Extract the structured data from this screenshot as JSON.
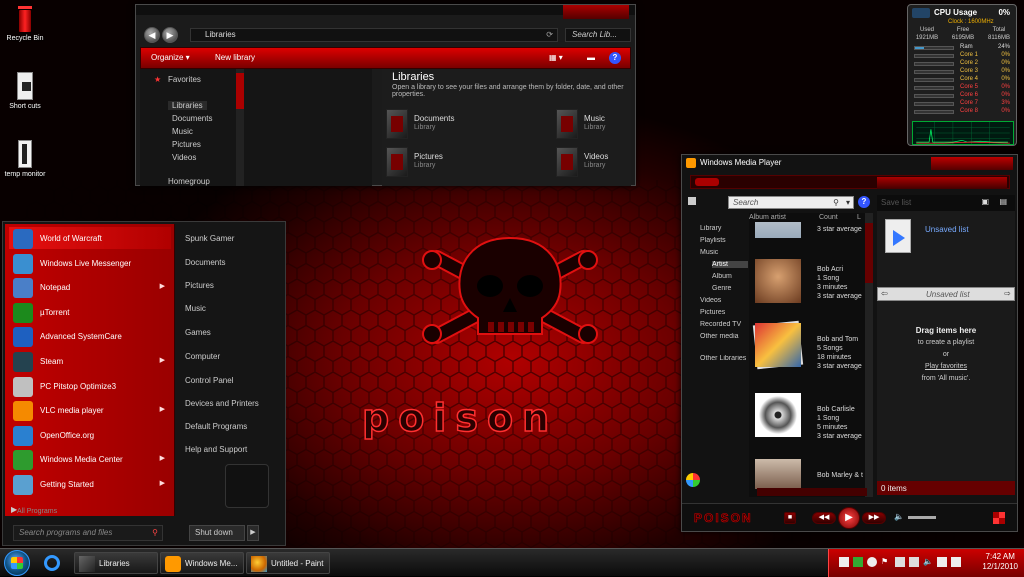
{
  "desktop_icons": [
    {
      "label": "Recycle Bin",
      "icon": "recycle-bin-icon"
    },
    {
      "label": "Short cuts",
      "icon": "shortcuts-folder-icon"
    },
    {
      "label": "temp monitor",
      "icon": "temp-monitor-icon"
    }
  ],
  "theme_logo_text": "poison",
  "explorer": {
    "address": "Libraries",
    "search_placeholder": "Search Lib...",
    "toolbar": {
      "organize": "Organize ▾",
      "new_library": "New library"
    },
    "nav": {
      "favorites": "Favorites",
      "libraries": "Libraries",
      "documents": "Documents",
      "music": "Music",
      "pictures": "Pictures",
      "videos": "Videos",
      "homegroup": "Homegroup"
    },
    "content_title": "Libraries",
    "content_subtitle": "Open a library to see your files and arrange them by folder, date, and other properties.",
    "libraries": [
      {
        "name": "Documents",
        "type": "Library"
      },
      {
        "name": "Music",
        "type": "Library"
      },
      {
        "name": "Pictures",
        "type": "Library"
      },
      {
        "name": "Videos",
        "type": "Library"
      }
    ]
  },
  "cpu_gadget": {
    "title": "CPU Usage",
    "total_percent": "0%",
    "clock": "Clock : 1600MHz",
    "mem_headers": [
      "Used",
      "Free",
      "Total"
    ],
    "mem_values": [
      "1921MB",
      "6195MB",
      "8116MB"
    ],
    "ram_label": "Ram",
    "ram_percent": "24%",
    "cores": [
      {
        "name": "Core 1",
        "value": "0%"
      },
      {
        "name": "Core 2",
        "value": "0%"
      },
      {
        "name": "Core 3",
        "value": "0%"
      },
      {
        "name": "Core 4",
        "value": "0%"
      },
      {
        "name": "Core 5",
        "value": "0%"
      },
      {
        "name": "Core 6",
        "value": "0%"
      },
      {
        "name": "Core 7",
        "value": "3%"
      },
      {
        "name": "Core 8",
        "value": "0%"
      }
    ],
    "colors": {
      "title": "#ffffff",
      "clock": "#f0b000",
      "core_low": "#f0c040",
      "core_high": "#ff4040"
    }
  },
  "start_menu": {
    "programs": [
      {
        "label": "World of Warcraft",
        "icon": "warcraft-icon",
        "arrow": false
      },
      {
        "label": "Windows Live Messenger",
        "icon": "messenger-icon",
        "arrow": false
      },
      {
        "label": "Notepad",
        "icon": "notepad-icon",
        "arrow": true
      },
      {
        "label": "µTorrent",
        "icon": "utorrent-icon",
        "arrow": false
      },
      {
        "label": "Advanced SystemCare",
        "icon": "systemcare-icon",
        "arrow": false
      },
      {
        "label": "Steam",
        "icon": "steam-icon",
        "arrow": true
      },
      {
        "label": "PC Pitstop Optimize3",
        "icon": "pitstop-icon",
        "arrow": false
      },
      {
        "label": "VLC media player",
        "icon": "vlc-icon",
        "arrow": true
      },
      {
        "label": "OpenOffice.org",
        "icon": "openoffice-icon",
        "arrow": false
      },
      {
        "label": "Windows Media Center",
        "icon": "media-center-icon",
        "arrow": true
      },
      {
        "label": "Getting Started",
        "icon": "getting-started-icon",
        "arrow": true
      }
    ],
    "all_programs": "All Programs",
    "right_items": [
      "Spunk Gamer",
      "Documents",
      "Pictures",
      "Music",
      "Games",
      "Computer",
      "Control Panel",
      "Devices and Printers",
      "Default Programs",
      "Help and Support"
    ],
    "search_placeholder": "Search programs and files",
    "shutdown": "Shut down"
  },
  "wmp": {
    "title": "Windows Media Player",
    "search_placeholder": "Search",
    "tree": [
      "Library",
      "Playlists",
      "Music",
      "Artist",
      "Album",
      "Genre",
      "Videos",
      "Pictures",
      "Recorded TV",
      "Other media",
      "Other Libraries"
    ],
    "columns": [
      "Album artist",
      "Count",
      "L"
    ],
    "artists": [
      {
        "name": "",
        "songs": "",
        "minutes": "",
        "rating": "3 star average"
      },
      {
        "name": "Bob Acri",
        "songs": "1 Song",
        "minutes": "3 minutes",
        "rating": "3 star average"
      },
      {
        "name": "Bob and Tom",
        "songs": "5 Songs",
        "minutes": "18 minutes",
        "rating": "3 star average"
      },
      {
        "name": "Bob Carlisle",
        "songs": "1 Song",
        "minutes": "5 minutes",
        "rating": "3 star average"
      },
      {
        "name": "Bob Marley & the Wailers",
        "songs": "",
        "minutes": "",
        "rating": ""
      }
    ],
    "save_list": "Save list",
    "unsaved_list": "Unsaved list",
    "unsaved_list_nav": "Unsaved list",
    "drag_title": "Drag items here",
    "drag_sub": "to create a playlist",
    "or": "or",
    "play_favorites": "Play favorites",
    "from_all_music": "from 'All music'.",
    "item_count": "0 items",
    "logo": "POISON"
  },
  "taskbar": {
    "buttons": [
      {
        "label": "Libraries",
        "icon": "folder-icon"
      },
      {
        "label": "Windows Me...",
        "icon": "wmp-icon"
      },
      {
        "label": "Untitled - Paint",
        "icon": "paint-icon"
      }
    ],
    "time": "7:42 AM",
    "date": "12/1/2010"
  }
}
